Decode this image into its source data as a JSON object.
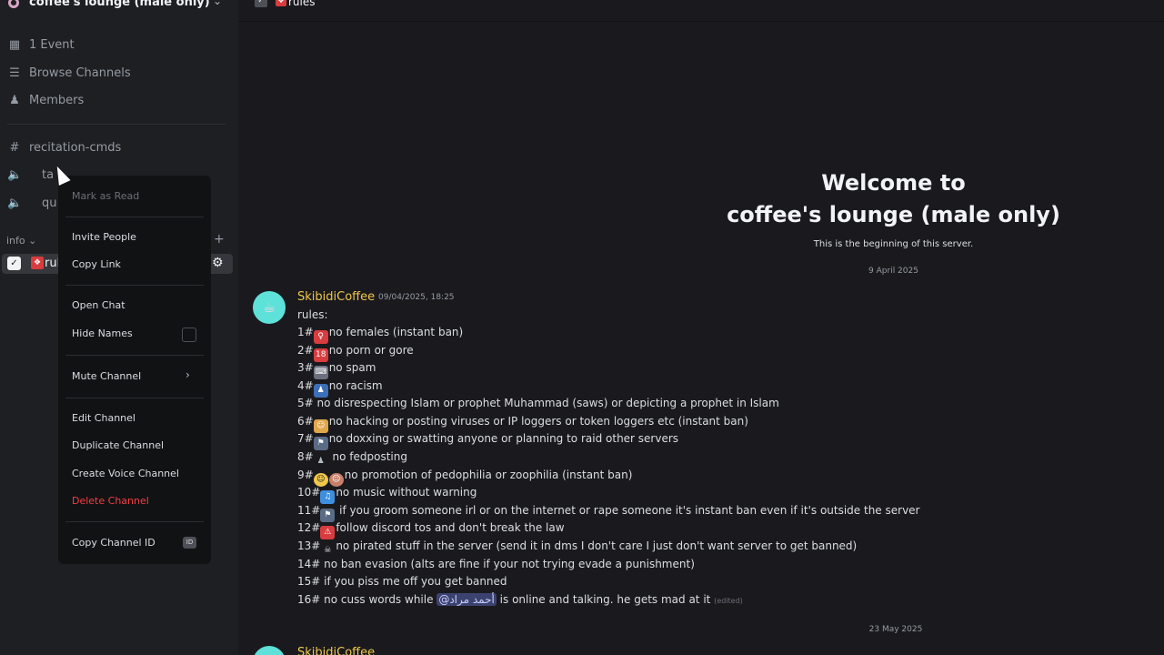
{
  "server": {
    "name": "coffee's lounge (male only)"
  },
  "sidebar": {
    "top_items": [
      {
        "label": "1 Event"
      },
      {
        "label": "Browse Channels"
      },
      {
        "label": "Members"
      }
    ],
    "channels": [
      {
        "label": "recitation-cmds"
      },
      {
        "label": "ta"
      },
      {
        "label": "qu"
      }
    ],
    "category": "info",
    "active_channel": "rul"
  },
  "context_menu": {
    "mark_as_read": "Mark as Read",
    "invite_people": "Invite People",
    "copy_link": "Copy Link",
    "open_chat": "Open Chat",
    "hide_names": "Hide Names",
    "mute_channel": "Mute Channel",
    "edit_channel": "Edit Channel",
    "duplicate_channel": "Duplicate Channel",
    "create_voice_channel": "Create Voice Channel",
    "delete_channel": "Delete Channel",
    "copy_channel_id": "Copy Channel ID",
    "id_badge": "ID"
  },
  "topbar": {
    "channel_name": "rules"
  },
  "welcome": {
    "line1": "Welcome to",
    "line2": "coffee's lounge (male only)",
    "subtitle": "This is the beginning of this server."
  },
  "dates": {
    "first": "9 April 2025",
    "second": "23 May 2025"
  },
  "message": {
    "author": "SkibidiCoffee",
    "timestamp": "09/04/2025, 18:25",
    "lines": [
      "rules:",
      "no females  (instant ban)",
      "no porn or gore",
      "no spam",
      "no racism",
      "no disrespecting Islam or prophet Muhammad (saws) or depicting a prophet in Islam",
      "no hacking or posting viruses or IP loggers or token loggers etc (instant ban)",
      "no doxxing or swatting anyone or planning to raid other servers",
      "no fedposting",
      "no promotion of pedophilia or zoophilia (instant ban)",
      "no music without warning",
      "if you groom someone irl or on the internet or rape someone  it's instant ban even if it's outside the server",
      "follow discord tos and  don't break the law",
      "no pirated stuff in the server (send it in dms I don't care I just don't want server  to get banned)",
      "no ban evasion (alts are fine if your not trying evade a punishment)",
      "if you piss me off you get banned",
      "no cuss words while",
      "is online and talking. he gets mad at it"
    ],
    "prefixes": [
      "1#",
      "2#",
      "3#",
      "4#",
      "5#",
      "6#",
      "7#",
      "8#",
      "9#",
      "10#",
      "11#",
      "12#",
      "13#",
      "14#",
      "15#",
      "16#"
    ],
    "mention": "@أحمد مراد",
    "edited": "(edited)"
  },
  "message2": {
    "author": "SkibidiCoffee"
  },
  "colors": {
    "author": "#f0c84b",
    "danger": "#f23f43",
    "mention_bg": "#3c4270"
  }
}
